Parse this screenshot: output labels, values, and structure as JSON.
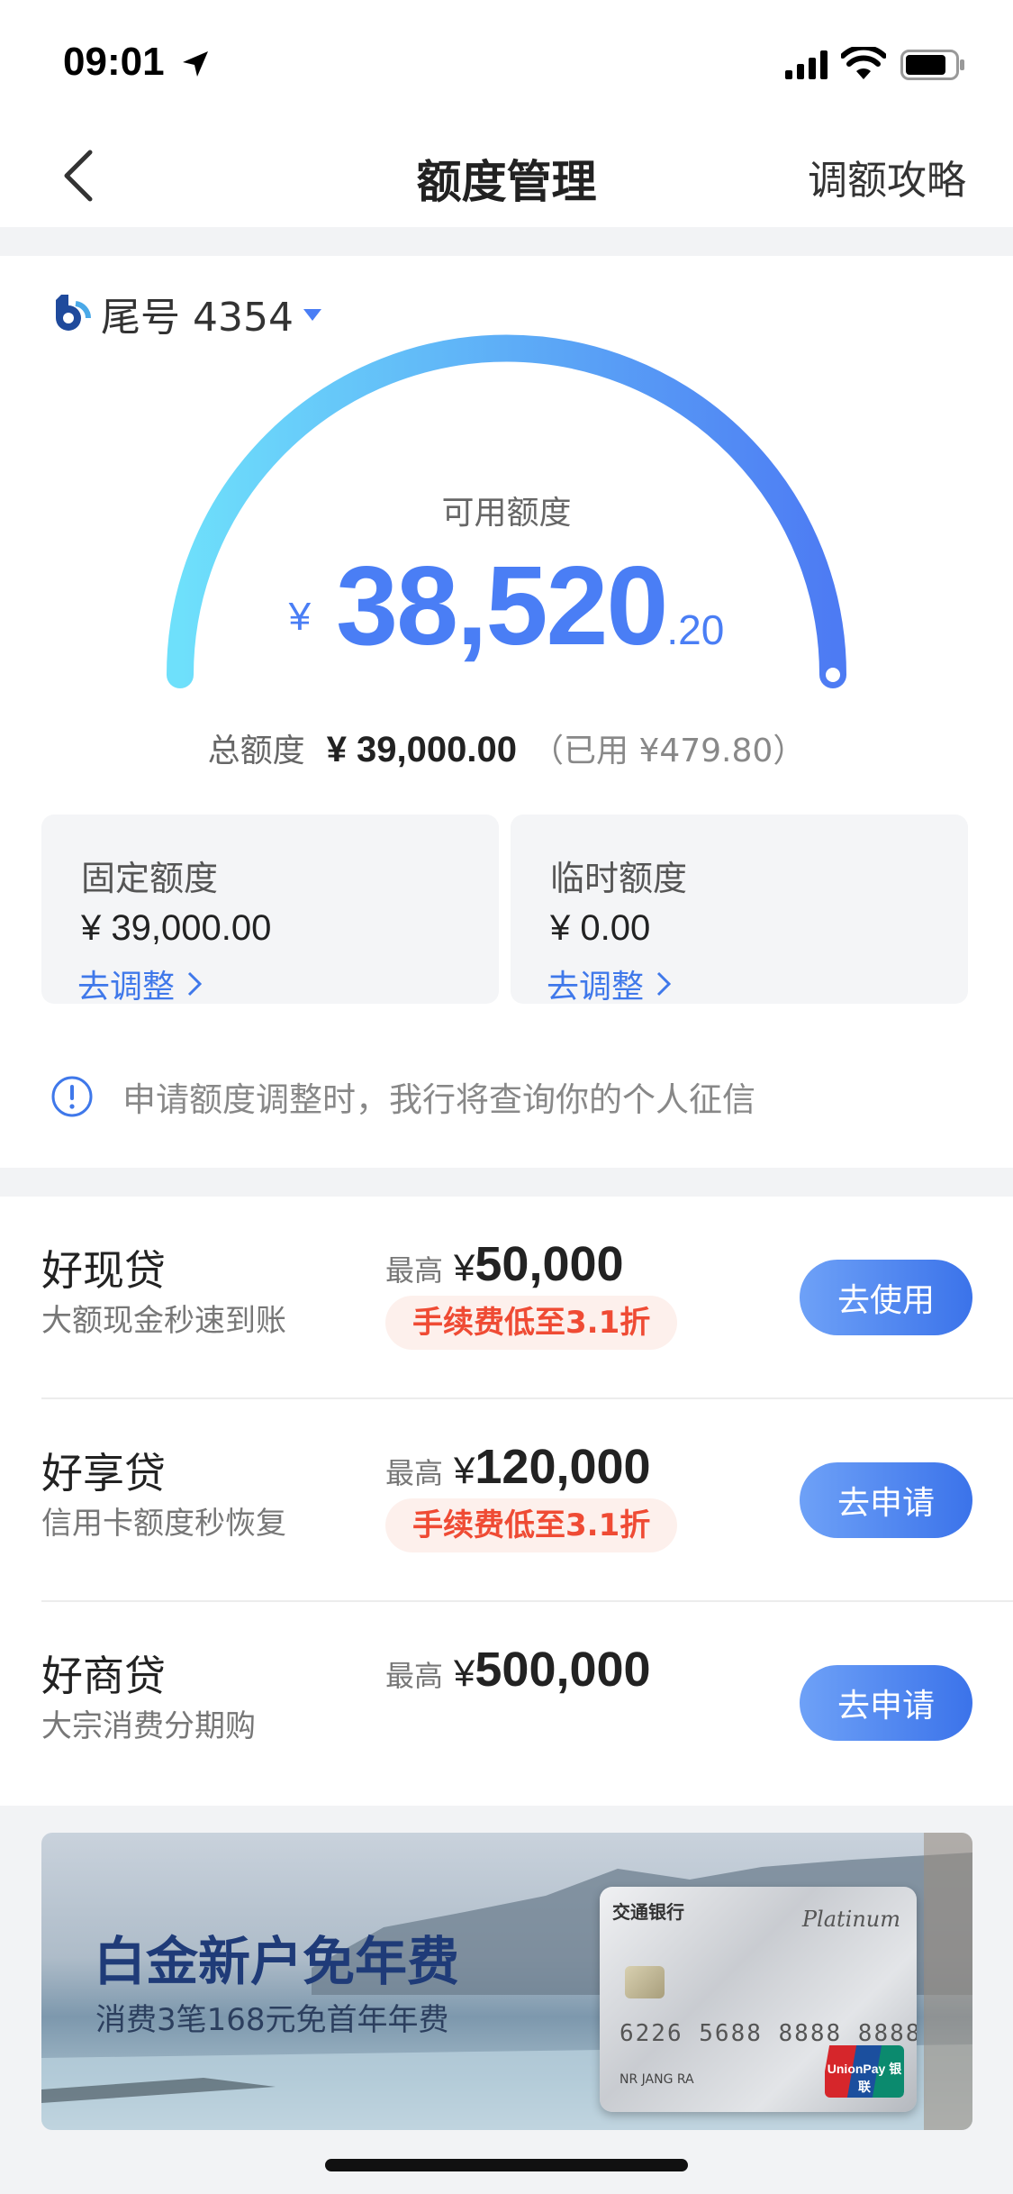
{
  "status_bar": {
    "time": "09:01"
  },
  "nav": {
    "title": "额度管理",
    "right_link": "调额攻略"
  },
  "account": {
    "label": "尾号 4354"
  },
  "gauge": {
    "label": "可用额度",
    "currency": "¥",
    "amount_int": "38,520",
    "amount_dec": ".20",
    "accent_start": "#6ee0fb",
    "accent_end": "#4d7bf3"
  },
  "total": {
    "label": "总额度",
    "value": "¥ 39,000.00",
    "used": "（已用 ¥479.80）"
  },
  "limits": {
    "fixed": {
      "title": "固定额度",
      "value": "¥ 39,000.00",
      "link": "去调整"
    },
    "temp": {
      "title": "临时额度",
      "value": "¥ 0.00",
      "link": "去调整"
    }
  },
  "notice": "申请额度调整时，我行将查询你的个人征信",
  "loans": [
    {
      "name": "好现贷",
      "desc": "大额现金秒速到账",
      "max_label": "最高",
      "currency": "¥",
      "max_value": "50,000",
      "badge": "手续费低至3.1折",
      "button": "去使用"
    },
    {
      "name": "好享贷",
      "desc": "信用卡额度秒恢复",
      "max_label": "最高",
      "currency": "¥",
      "max_value": "120,000",
      "badge": "手续费低至3.1折",
      "button": "去申请"
    },
    {
      "name": "好商贷",
      "desc": "大宗消费分期购",
      "max_label": "最高",
      "currency": "¥",
      "max_value": "500,000",
      "badge": "",
      "button": "去申请"
    }
  ],
  "banner": {
    "title": "白金新户免年费",
    "subtitle": "消费3笔168元免首年年费",
    "card": {
      "bank": "交通银行",
      "tier": "Platinum",
      "number": "6226 5688 8888 8888",
      "holder": "NR JANG RA",
      "network": "UnionPay 银联"
    }
  }
}
